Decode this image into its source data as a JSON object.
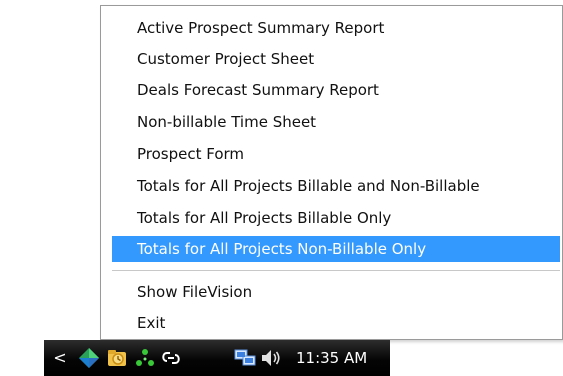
{
  "menu": {
    "items": [
      {
        "label": "Active Prospect Summary  Report"
      },
      {
        "label": "Customer Project Sheet"
      },
      {
        "label": "Deals Forecast Summary  Report"
      },
      {
        "label": "Non-billable Time Sheet"
      },
      {
        "label": "Prospect Form"
      },
      {
        "label": "Totals for All Projects Billable and Non-Billable"
      },
      {
        "label": "Totals for All Projects Billable Only"
      },
      {
        "label": "Totals for All Projects Non-Billable Only"
      }
    ],
    "highlighted_index": 7,
    "secondary_items": [
      {
        "label": "Show FileVision"
      },
      {
        "label": "Exit"
      }
    ],
    "highlight_color": "#3399ff"
  },
  "taskbar": {
    "chevron_label": "<",
    "icons": [
      "app-diamond-icon",
      "folder-badge-icon",
      "network-dots-icon",
      "link-icon",
      "network-monitor-icon",
      "speaker-icon"
    ],
    "clock": "11:35 AM"
  }
}
